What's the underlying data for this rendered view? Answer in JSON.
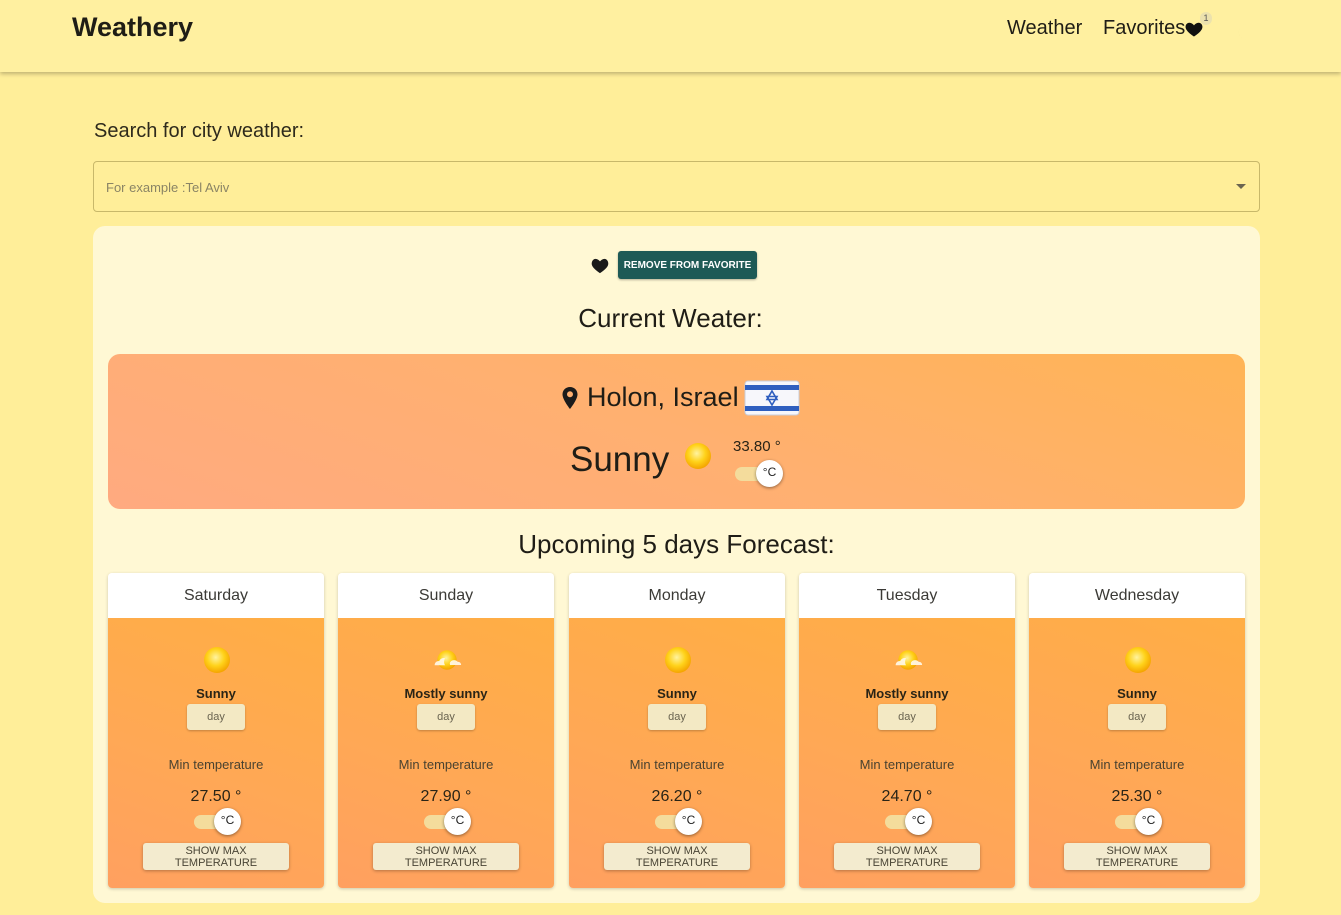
{
  "header": {
    "brand": "Weathery",
    "nav": {
      "weather": "Weather",
      "favorites": "Favorites",
      "favorites_count": "1"
    }
  },
  "search": {
    "label": "Search for city weather:",
    "placeholder": "For example :Tel Aviv"
  },
  "favorite": {
    "remove_label": "REMOVE FROM FAVORITE"
  },
  "current": {
    "title": "Current Weater:",
    "location": "Holon, Israel",
    "condition": "Sunny",
    "temperature": "33.80 °",
    "unit": "°C"
  },
  "forecast": {
    "title": "Upcoming 5 days Forecast:",
    "min_label": "Min temperature",
    "max_button": "SHOW MAX TEMPERATURE",
    "unit": "°C",
    "days": [
      {
        "day": "Saturday",
        "condition": "Sunny",
        "period": "day",
        "min": "27.50 °",
        "icon": "sun-icon"
      },
      {
        "day": "Sunday",
        "condition": "Mostly sunny",
        "period": "day",
        "min": "27.90 °",
        "icon": "mostly-sunny-icon"
      },
      {
        "day": "Monday",
        "condition": "Sunny",
        "period": "day",
        "min": "26.20 °",
        "icon": "sun-icon"
      },
      {
        "day": "Tuesday",
        "condition": "Mostly sunny",
        "period": "day",
        "min": "24.70 °",
        "icon": "mostly-sunny-icon"
      },
      {
        "day": "Wednesday",
        "condition": "Sunny",
        "period": "day",
        "min": "25.30 °",
        "icon": "sun-icon"
      }
    ]
  },
  "colors": {
    "page_bg": "#ffee99",
    "card_bg": "#fff8d4",
    "button_teal": "#1e5a56",
    "panel_orange": "#ffb070"
  }
}
